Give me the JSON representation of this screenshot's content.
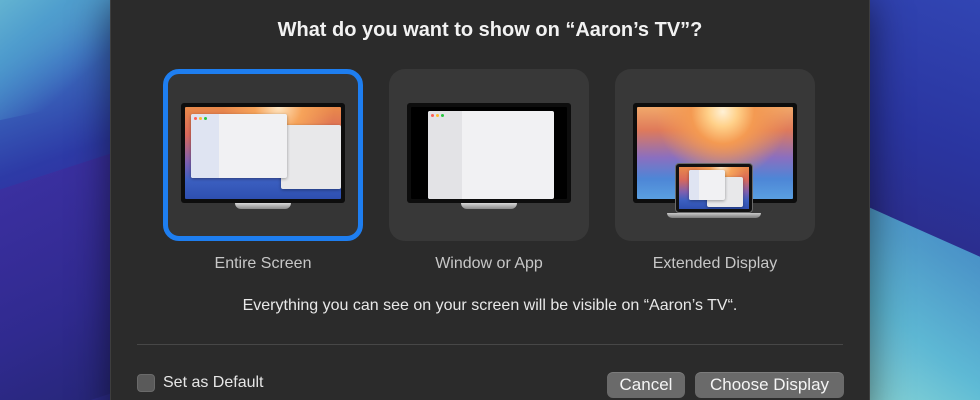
{
  "dialog": {
    "title": "What do you want to show on “Aaron’s TV”?",
    "message": "Everything you can see on your screen will be visible on “Aaron’s TV“."
  },
  "options": [
    {
      "label": "Entire Screen",
      "selected": true
    },
    {
      "label": "Window or App",
      "selected": false
    },
    {
      "label": "Extended Display",
      "selected": false
    }
  ],
  "footer": {
    "checkbox_label": "Set as Default",
    "checkbox_checked": false,
    "cancel_label": "Cancel",
    "choose_label": "Choose Display"
  },
  "colors": {
    "accent": "#1e7ef0",
    "dialog_bg": "#2b2b2b"
  }
}
